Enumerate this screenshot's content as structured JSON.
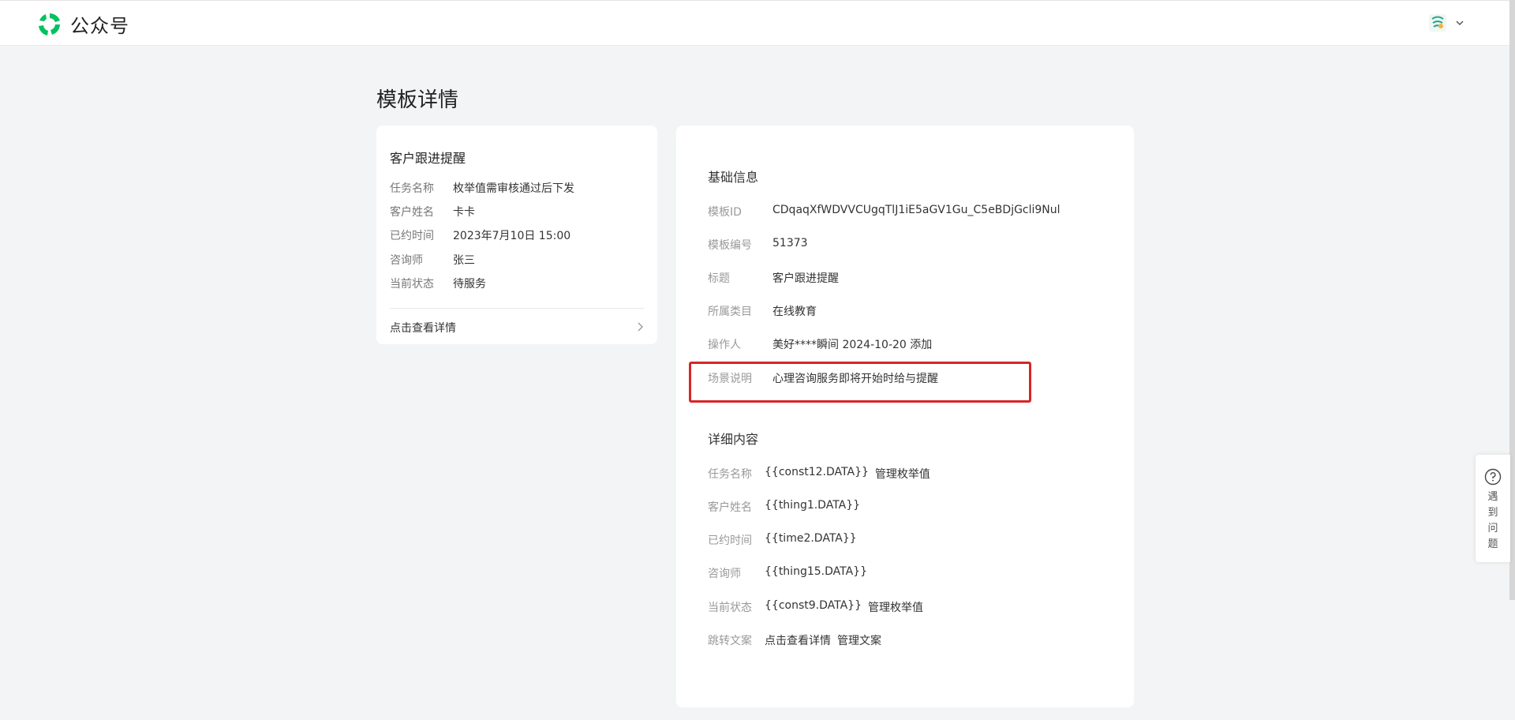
{
  "header": {
    "app_name": "公众号",
    "logo_icon": "wechat-mp-logo-icon",
    "avatar_icon": "user-avatar-icon",
    "account_menu_icon": "chevron-down-icon"
  },
  "page": {
    "title": "模板详情"
  },
  "preview_card": {
    "title": "客户跟进提醒",
    "fields": [
      {
        "label": "任务名称",
        "value": "枚举值需审核通过后下发"
      },
      {
        "label": "客户姓名",
        "value": "卡卡"
      },
      {
        "label": "已约时间",
        "value": "2023年7月10日 15:00"
      },
      {
        "label": "咨询师",
        "value": "张三"
      },
      {
        "label": "当前状态",
        "value": "待服务"
      }
    ],
    "link_label": "点击查看详情"
  },
  "basic_info": {
    "title": "基础信息",
    "fields": [
      {
        "label": "模板ID",
        "value": "CDqaqXfWDVVCUgqTlJ1iE5aGV1Gu_C5eBDjGcli9Nul"
      },
      {
        "label": "模板编号",
        "value": "51373"
      },
      {
        "label": "标题",
        "value": "客户跟进提醒"
      },
      {
        "label": "所属类目",
        "value": "在线教育"
      },
      {
        "label": "操作人",
        "value": "美好****瞬间 2024-10-20 添加"
      },
      {
        "label": "场景说明",
        "value": "心理咨询服务即将开始时给与提醒"
      }
    ]
  },
  "detail_content": {
    "title": "详细内容",
    "fields": [
      {
        "label": "任务名称",
        "value": "{{const12.DATA}}",
        "action": "管理枚举值"
      },
      {
        "label": "客户姓名",
        "value": "{{thing1.DATA}}",
        "action": ""
      },
      {
        "label": "已约时间",
        "value": "{{time2.DATA}}",
        "action": ""
      },
      {
        "label": "咨询师",
        "value": "{{thing15.DATA}}",
        "action": ""
      },
      {
        "label": "当前状态",
        "value": "{{const9.DATA}}",
        "action": "管理枚举值"
      },
      {
        "label": "跳转文案",
        "value": "点击查看详情",
        "action": "管理文案"
      }
    ]
  },
  "help": {
    "label_chars": [
      "遇",
      "到",
      "问",
      "题"
    ],
    "icon": "question-circle-icon"
  },
  "colors": {
    "brand_green": "#07c160",
    "highlight_red": "#d82525"
  }
}
